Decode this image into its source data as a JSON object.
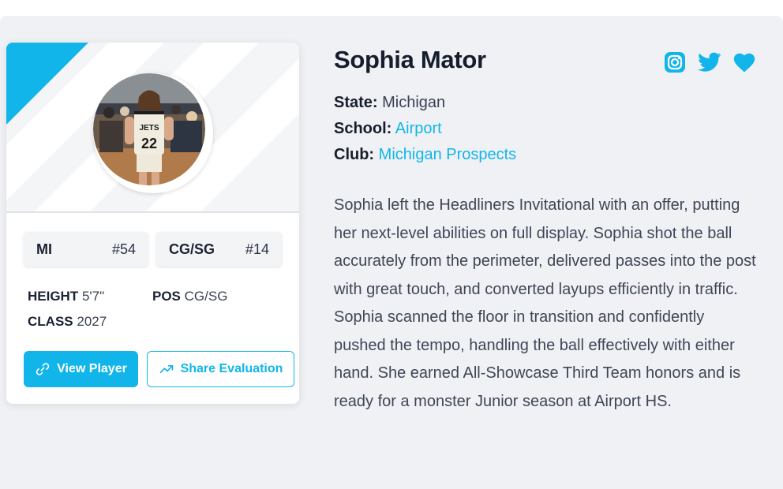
{
  "player": {
    "name": "Sophia Mator",
    "state_label": "State:",
    "state": "Michigan",
    "school_label": "School:",
    "school": "Airport",
    "club_label": "Club:",
    "club": "Michigan Prospects",
    "bio": "Sophia left the Headliners Invitational with an offer, putting her next-level abilities on full display. Sophia shot the ball accurately from the perimeter, delivered passes into the post with great touch, and converted layups efficiently in traffic. Sophia scanned the floor in transition and confidently pushed the tempo, handling the ball effectively with either hand. She earned All-Showcase Third Team honors and is ready for a monster Junior season at Airport HS."
  },
  "card": {
    "chip_state": {
      "label": "MI",
      "value": "#54"
    },
    "chip_position": {
      "label": "CG/SG",
      "value": "#14"
    },
    "height_label": "HEIGHT",
    "height": "5'7\"",
    "pos_label": "POS",
    "pos": "CG/SG",
    "class_label": "CLASS",
    "class": "2027",
    "view_player_label": "View Player",
    "share_label": "Share Evaluation",
    "jersey_text": "JETS",
    "jersey_number": "22"
  },
  "social": {
    "icons": [
      "instagram-icon",
      "twitter-icon",
      "heart-icon"
    ]
  },
  "colors": {
    "accent": "#12b5ea",
    "panel_bg": "#eff1f4",
    "text_dark": "#161d2d"
  }
}
